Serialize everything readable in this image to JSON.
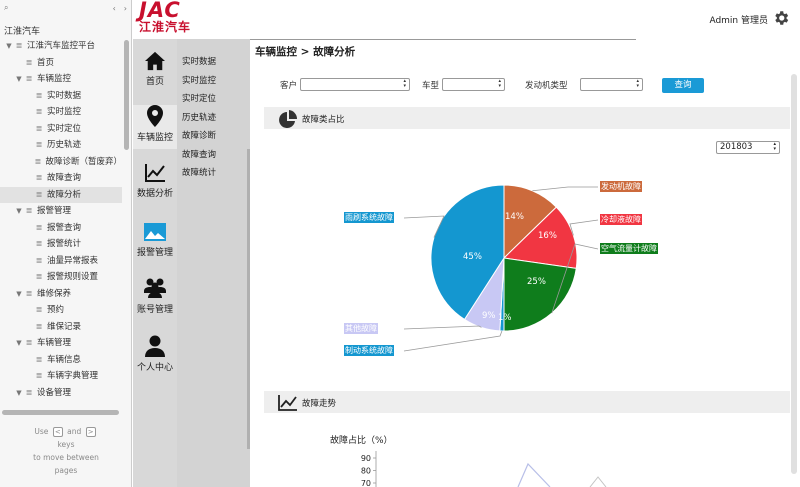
{
  "outline": {
    "title": "江淮汽车",
    "tree": [
      {
        "label": "江淮汽车监控平台",
        "depth": 0,
        "toggle": "▼"
      },
      {
        "label": "首页",
        "depth": 1,
        "toggle": ""
      },
      {
        "label": "车辆监控",
        "depth": 1,
        "toggle": "▼"
      },
      {
        "label": "实时数据",
        "depth": 2,
        "toggle": ""
      },
      {
        "label": "实时监控",
        "depth": 2,
        "toggle": ""
      },
      {
        "label": "实时定位",
        "depth": 2,
        "toggle": ""
      },
      {
        "label": "历史轨迹",
        "depth": 2,
        "toggle": ""
      },
      {
        "label": "故障诊断（暂废弃）",
        "depth": 2,
        "toggle": ""
      },
      {
        "label": "故障查询",
        "depth": 2,
        "toggle": ""
      },
      {
        "label": "故障分析",
        "depth": 2,
        "toggle": "",
        "selected": true
      },
      {
        "label": "报警管理",
        "depth": 1,
        "toggle": "▼"
      },
      {
        "label": "报警查询",
        "depth": 2,
        "toggle": ""
      },
      {
        "label": "报警统计",
        "depth": 2,
        "toggle": ""
      },
      {
        "label": "油量异常报表",
        "depth": 2,
        "toggle": ""
      },
      {
        "label": "报警规则设置",
        "depth": 2,
        "toggle": ""
      },
      {
        "label": "维修保养",
        "depth": 1,
        "toggle": "▼"
      },
      {
        "label": "预约",
        "depth": 2,
        "toggle": ""
      },
      {
        "label": "维保记录",
        "depth": 2,
        "toggle": ""
      },
      {
        "label": "车辆管理",
        "depth": 1,
        "toggle": "▼"
      },
      {
        "label": "车辆信息",
        "depth": 2,
        "toggle": ""
      },
      {
        "label": "车辆字典管理",
        "depth": 2,
        "toggle": ""
      },
      {
        "label": "设备管理",
        "depth": 1,
        "toggle": "▼"
      }
    ],
    "hint_use": "Use",
    "hint_and": "and",
    "hint_keys": "keys",
    "hint_rest": "to move between",
    "hint_pages": "pages",
    "key_left": "<",
    "key_right": ">"
  },
  "header": {
    "logo_text": "JAC",
    "logo_cn": "江淮汽车",
    "user": "Admin 管理员",
    "icon": "gear-icon"
  },
  "nav1": [
    {
      "label": "首页",
      "icon": "home-icon",
      "active": false
    },
    {
      "label": "车辆监控",
      "icon": "location-pin-icon",
      "active": true
    },
    {
      "label": "数据分析",
      "icon": "line-chart-icon",
      "active": false
    },
    {
      "label": "报警管理",
      "icon": "image-icon",
      "active": false
    },
    {
      "label": "账号管理",
      "icon": "users-icon",
      "active": false
    },
    {
      "label": "个人中心",
      "icon": "person-icon",
      "active": false
    }
  ],
  "nav2": [
    "实时数据",
    "实时监控",
    "实时定位",
    "历史轨迹",
    "故障诊断",
    "故障查询",
    "故障统计"
  ],
  "breadcrumb": "车辆监控 > 故障分析",
  "filters": {
    "customer_label": "客户",
    "model_label": "车型",
    "engine_label": "发动机类型",
    "query_button": "查询"
  },
  "section1": {
    "title": "故障类占比",
    "icon": "pie-chart-icon",
    "date": "201803"
  },
  "section2": {
    "title": "故障走势",
    "icon": "line-chart-icon"
  },
  "chart_data": [
    {
      "type": "pie",
      "slices": [
        {
          "name": "发动机故障",
          "value": 14,
          "label": "14%",
          "color": "#cc6a3c"
        },
        {
          "name": "冷却液故障",
          "value": 16,
          "label": "16%",
          "color": "#f13642"
        },
        {
          "name": "空气流量计故障",
          "value": 25,
          "label": "25%",
          "color": "#0f7d1c"
        },
        {
          "name": "制动系统故障",
          "value": 1,
          "label": "1%",
          "color": "#1497d0"
        },
        {
          "name": "其他故障",
          "value": 9,
          "label": "9%",
          "color": "#c8c8f4"
        },
        {
          "name": "雨刷系统故障",
          "value": 45,
          "label": "45%",
          "color": "#1497d0"
        }
      ]
    },
    {
      "type": "line",
      "ylabel": "故障占比（%）",
      "yticks": [
        90,
        80,
        70
      ]
    }
  ]
}
